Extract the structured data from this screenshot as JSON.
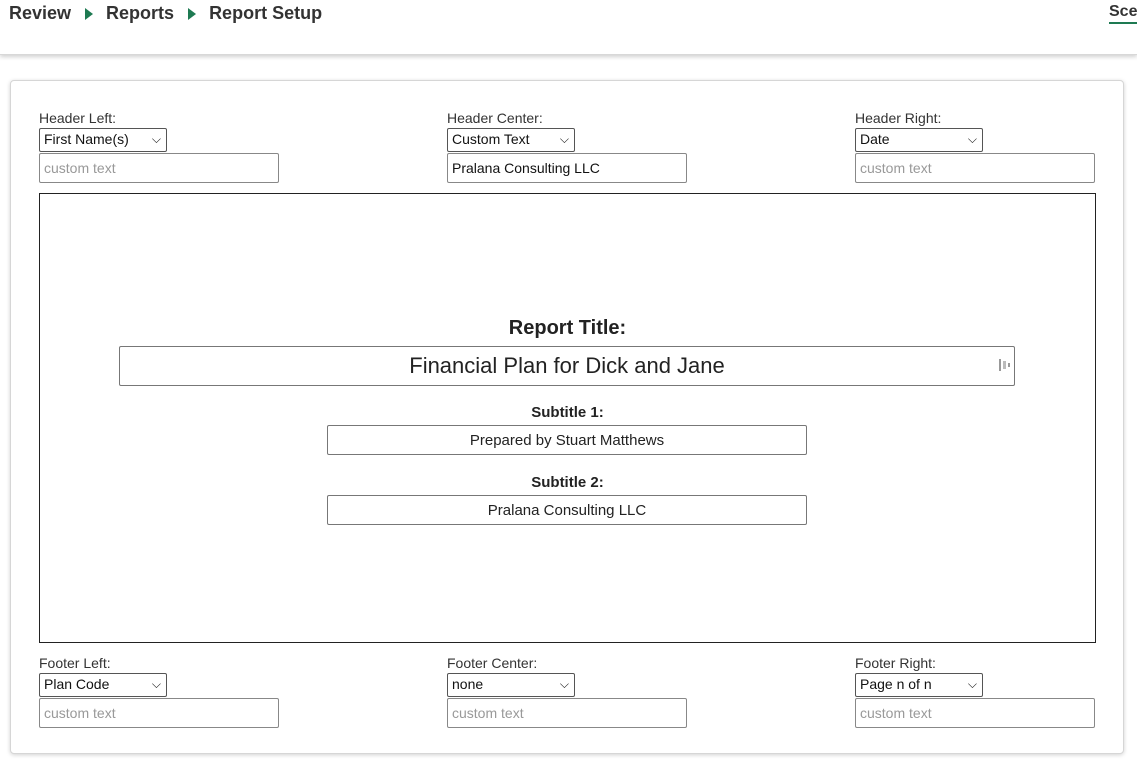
{
  "breadcrumb": {
    "items": [
      "Review",
      "Reports",
      "Report Setup"
    ]
  },
  "topright": {
    "label": "Scen"
  },
  "header": {
    "left": {
      "label": "Header Left:",
      "selected": "First Name(s)",
      "custom_value": "",
      "placeholder": "custom text"
    },
    "center": {
      "label": "Header Center:",
      "selected": "Custom Text",
      "custom_value": "Pralana Consulting LLC",
      "placeholder": "custom text"
    },
    "right": {
      "label": "Header Right:",
      "selected": "Date",
      "custom_value": "",
      "placeholder": "custom text"
    }
  },
  "preview": {
    "title_label": "Report Title:",
    "title_value": "Financial Plan for Dick and Jane",
    "subtitle1_label": "Subtitle 1:",
    "subtitle1_value": "Prepared by Stuart Matthews",
    "subtitle2_label": "Subtitle 2:",
    "subtitle2_value": "Pralana Consulting LLC"
  },
  "footer": {
    "left": {
      "label": "Footer Left:",
      "selected": "Plan Code",
      "custom_value": "",
      "placeholder": "custom text"
    },
    "center": {
      "label": "Footer Center:",
      "selected": "none",
      "custom_value": "",
      "placeholder": "custom text"
    },
    "right": {
      "label": "Footer Right:",
      "selected": "Page n of n",
      "custom_value": "",
      "placeholder": "custom text"
    }
  },
  "colors": {
    "accent": "#1e7a52",
    "border": "#222222"
  }
}
